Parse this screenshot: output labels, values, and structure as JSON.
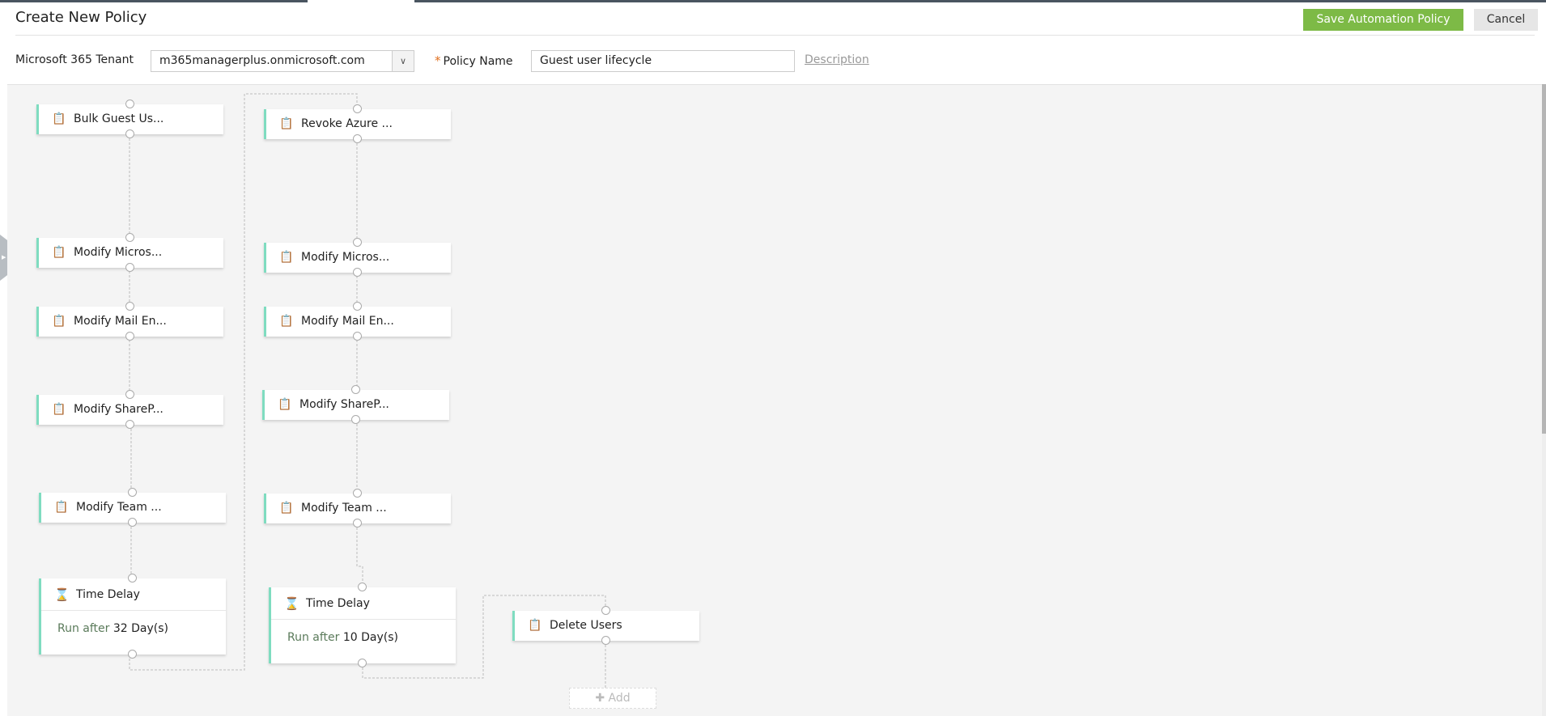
{
  "header": {
    "title": "Create New Policy",
    "save_label": "Save Automation Policy",
    "cancel_label": "Cancel"
  },
  "form": {
    "tenant_label": "Microsoft 365 Tenant",
    "tenant_value": "m365managerplus.onmicrosoft.com",
    "required_mark": "*",
    "policy_name_label": "Policy Name",
    "policy_name_value": "Guest user lifecycle",
    "description_link": "Description"
  },
  "colors": {
    "accent": "#7dba46",
    "node_border": "#7fdcc0"
  },
  "workflow": {
    "col1": [
      "Bulk Guest Us...",
      "Modify Micros...",
      "Modify Mail En...",
      "Modify ShareP...",
      "Modify Team ..."
    ],
    "col1_delay": {
      "title": "Time Delay",
      "run_after": "Run after",
      "value": "32 Day(s)"
    },
    "col2": [
      "Revoke Azure ...",
      "Modify Micros...",
      "Modify Mail En...",
      "Modify ShareP...",
      "Modify Team ..."
    ],
    "col2_delay": {
      "title": "Time Delay",
      "run_after": "Run after",
      "value": "10 Day(s)"
    },
    "final": "Delete Users",
    "add_label": "Add"
  }
}
